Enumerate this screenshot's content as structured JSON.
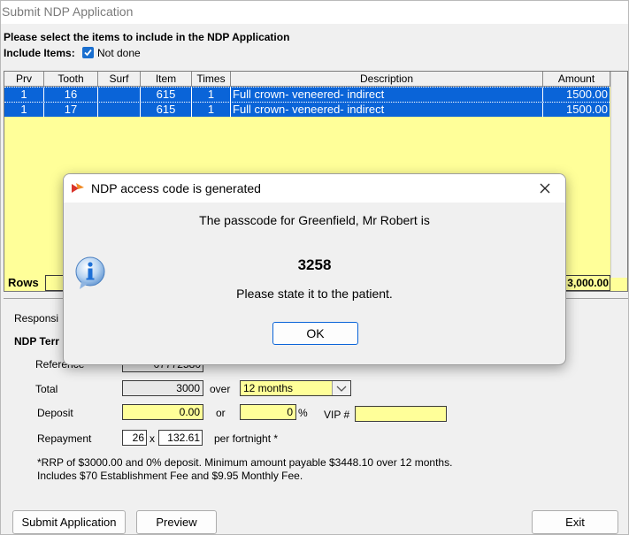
{
  "window": {
    "title": "Submit NDP Application"
  },
  "instructions": "Please select the items to include in the NDP Application",
  "include_items": {
    "label": "Include Items:",
    "checkbox_label": "Not done"
  },
  "table": {
    "headers": [
      "Prv",
      "Tooth",
      "Surf",
      "Item",
      "Times",
      "Description",
      "Amount"
    ],
    "rows": [
      {
        "prv": "1",
        "tooth": "16",
        "surf": "",
        "item": "615",
        "times": "1",
        "description": "Full crown- veneered- indirect",
        "amount": "1500.00"
      },
      {
        "prv": "1",
        "tooth": "17",
        "surf": "",
        "item": "615",
        "times": "1",
        "description": "Full crown- veneered- indirect",
        "amount": "1500.00"
      }
    ],
    "rows_label": "Rows",
    "total_partial": "3,000.00"
  },
  "section": {
    "responsible_partial": "Responsi",
    "ndp_terms_partial": "NDP Terr",
    "reference_label": "Reference",
    "reference_value": "07772580"
  },
  "form": {
    "total_label": "Total",
    "total_value": "3000",
    "over_label": "over",
    "months_value": "12 months",
    "deposit_label": "Deposit",
    "deposit_value": "0.00",
    "or_label": "or",
    "percent_value": "0",
    "percent_symbol": "%",
    "vip_label": "VIP #",
    "vip_value": "",
    "repayment_label": "Repayment",
    "repayment_count": "26",
    "times_symbol": "x",
    "repayment_amount": "132.61",
    "per_fortnight": "per fortnight *",
    "note_line1": "*RRP of $3000.00 and 0% deposit. Minimum amount payable $3448.10 over 12 months.",
    "note_line2": "Includes $70 Establishment Fee and $9.95 Monthly Fee."
  },
  "buttons": {
    "submit": "Submit Application",
    "preview": "Preview",
    "exit": "Exit"
  },
  "dialog": {
    "title": "NDP access code is generated",
    "line1": "The passcode for Greenfield, Mr Robert is",
    "code": "3258",
    "line2": "Please state it to the patient.",
    "ok": "OK"
  },
  "colors": {
    "selection": "#0a64d8",
    "yellow": "#ffff99",
    "checkbox": "#1a6fcf",
    "info_icon": "#1d6fd6"
  }
}
